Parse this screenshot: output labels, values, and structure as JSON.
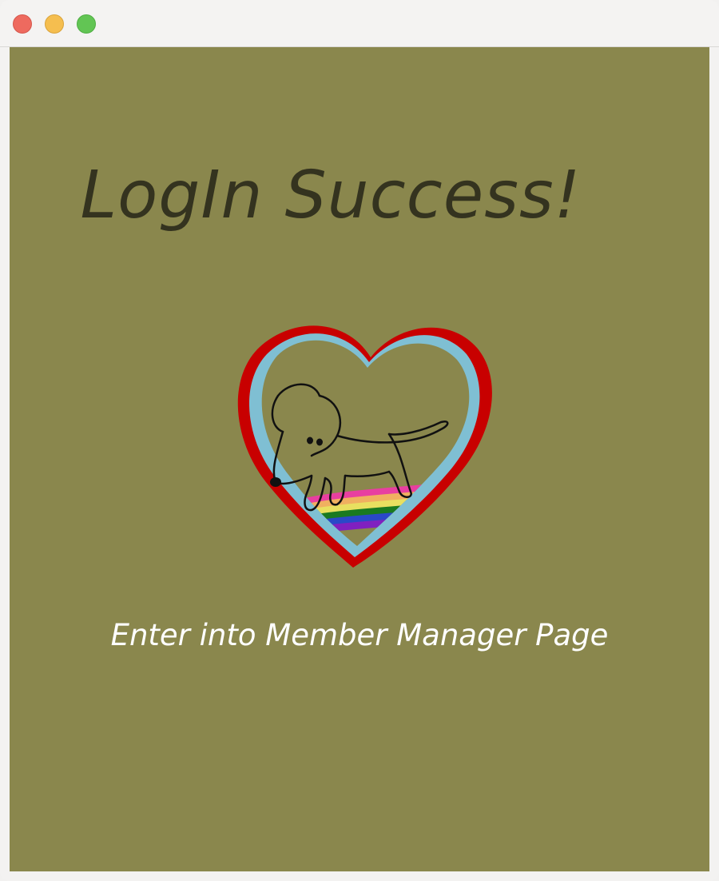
{
  "window": {
    "controls": {
      "close_color": "#ee6a5f",
      "minimize_color": "#f5be4f",
      "zoom_color": "#62c554"
    },
    "background_color": "#8a874d"
  },
  "main": {
    "title": "LogIn Success!",
    "logo": {
      "icon": "dog-rainbow-heart-logo"
    },
    "enter_link": "Enter into Member Manager Page"
  }
}
